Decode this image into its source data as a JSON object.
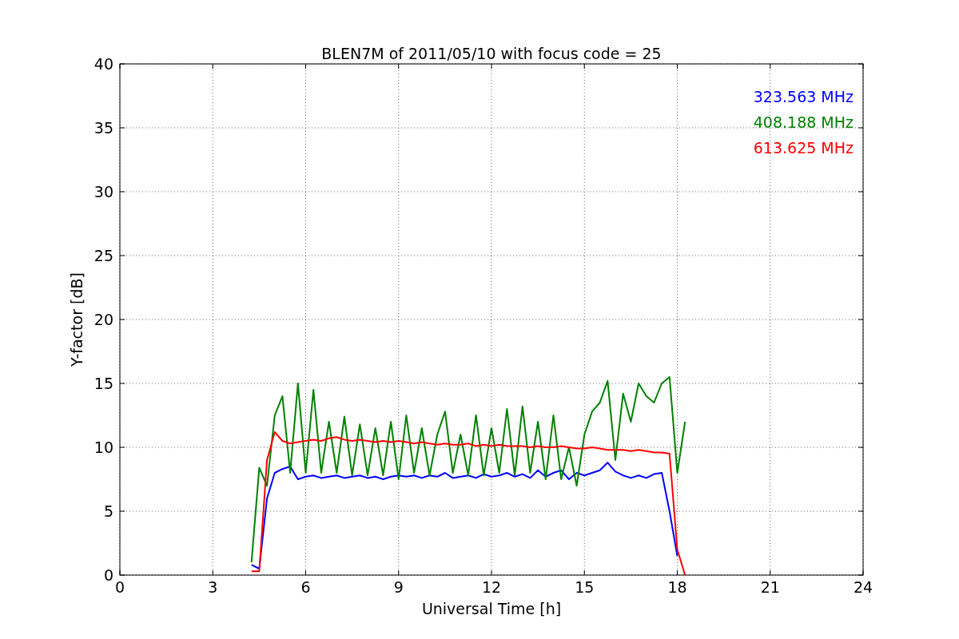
{
  "chart_data": {
    "type": "line",
    "title": "BLEN7M of 2011/05/10 with focus code = 25",
    "xlabel": "Universal Time [h]",
    "ylabel": "Y-factor [dB]",
    "xlim": [
      0,
      24
    ],
    "ylim": [
      0,
      40
    ],
    "xticks": [
      0,
      3,
      6,
      9,
      12,
      15,
      18,
      21,
      24
    ],
    "yticks": [
      0,
      5,
      10,
      15,
      20,
      25,
      30,
      35,
      40
    ],
    "grid": true,
    "x": [
      4.25,
      4.5,
      4.75,
      5,
      5.25,
      5.5,
      5.75,
      6,
      6.25,
      6.5,
      6.75,
      7,
      7.25,
      7.5,
      7.75,
      8,
      8.25,
      8.5,
      8.75,
      9,
      9.25,
      9.5,
      9.75,
      10,
      10.25,
      10.5,
      10.75,
      11,
      11.25,
      11.5,
      11.75,
      12,
      12.25,
      12.5,
      12.75,
      13,
      13.25,
      13.5,
      13.75,
      14,
      14.25,
      14.5,
      14.75,
      15,
      15.25,
      15.5,
      15.75,
      16,
      16.25,
      16.5,
      16.75,
      17,
      17.25,
      17.5,
      17.75,
      18,
      18.25
    ],
    "series": [
      {
        "name": "323.563 MHz",
        "color": "#0000ff",
        "values": [
          0.8,
          0.5,
          6,
          8,
          8.3,
          8.5,
          7.5,
          7.7,
          7.8,
          7.6,
          7.7,
          7.8,
          7.6,
          7.7,
          7.8,
          7.6,
          7.7,
          7.5,
          7.7,
          7.8,
          7.7,
          7.8,
          7.6,
          7.8,
          7.7,
          8,
          7.6,
          7.7,
          7.8,
          7.6,
          7.9,
          7.7,
          7.8,
          8,
          7.7,
          7.9,
          7.6,
          8.2,
          7.7,
          8,
          8.2,
          7.5,
          8,
          7.8,
          8,
          8.2,
          8.8,
          8.1,
          7.8,
          7.6,
          7.8,
          7.6,
          7.9,
          8,
          5,
          1.5,
          null
        ]
      },
      {
        "name": "408.188 MHz",
        "color": "#008000",
        "values": [
          1,
          8.4,
          7,
          12.5,
          14,
          8,
          15,
          8,
          14.5,
          8,
          12,
          8,
          12.4,
          7.8,
          11.8,
          7.8,
          11.5,
          7.8,
          12,
          7.5,
          12.5,
          8,
          11.5,
          7.8,
          11,
          12.8,
          8,
          11,
          7.8,
          12.5,
          7.8,
          11.5,
          8,
          13,
          7.8,
          13.2,
          8,
          12,
          7.5,
          12.5,
          7.5,
          10,
          7,
          11,
          12.8,
          13.5,
          15.2,
          9,
          14.2,
          12,
          15,
          14,
          13.5,
          15,
          15.5,
          8,
          12
        ]
      },
      {
        "name": "613.625 MHz",
        "color": "#ff0000",
        "values": [
          0.3,
          0.3,
          9,
          11.2,
          10.5,
          10.3,
          10.4,
          10.5,
          10.6,
          10.5,
          10.7,
          10.8,
          10.6,
          10.5,
          10.6,
          10.5,
          10.4,
          10.5,
          10.4,
          10.5,
          10.4,
          10.3,
          10.4,
          10.3,
          10.2,
          10.3,
          10.2,
          10.2,
          10.3,
          10.1,
          10.2,
          10.1,
          10.2,
          10.1,
          10.1,
          10.1,
          10,
          10.1,
          10,
          10,
          10.1,
          10,
          9.9,
          9.9,
          10,
          9.9,
          9.8,
          9.8,
          9.8,
          9.7,
          9.8,
          9.7,
          9.6,
          9.6,
          9.5,
          2,
          0
        ]
      }
    ]
  }
}
